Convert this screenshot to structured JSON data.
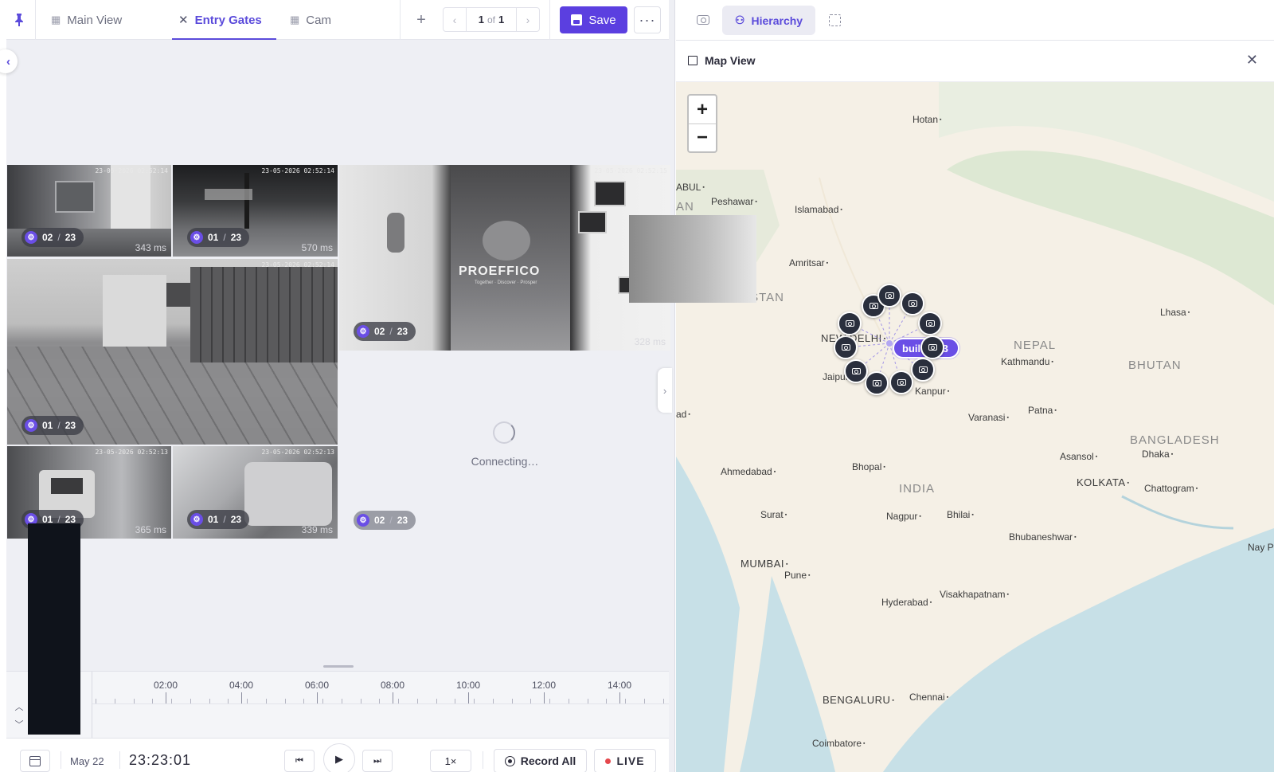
{
  "tabs": [
    {
      "label": "Main View",
      "icon": "layout-icon",
      "active": false
    },
    {
      "label": "Entry Gates",
      "icon": "close-icon",
      "active": true
    },
    {
      "label": "Cam",
      "icon": "layout-icon",
      "active": false
    }
  ],
  "pager": {
    "current": "1",
    "of_label": "of",
    "total": "1"
  },
  "toolbar": {
    "save_label": "Save",
    "more_label": "···"
  },
  "cameras": [
    {
      "stamp": "23-05-2026 02:52:14",
      "count": "02",
      "sep": "/",
      "total": "23",
      "latency": "343 ms"
    },
    {
      "stamp": "23-05-2026 02:52:14",
      "count": "01",
      "sep": "/",
      "total": "23",
      "latency": "570 ms"
    },
    {
      "stamp": "23-05-2026 02:52:15",
      "count": "02",
      "sep": "/",
      "total": "23",
      "latency": "328 ms",
      "watermark": "PROEFFICO",
      "watermark_sub": "Together · Discover · Prosper"
    },
    {
      "stamp": "23-05-2026 02:52:14",
      "count": "01",
      "sep": "/",
      "total": "23",
      "latency": ""
    },
    {
      "stamp": "23-05-2026 02:52:13",
      "count": "01",
      "sep": "/",
      "total": "23",
      "latency": "365 ms"
    },
    {
      "stamp": "23-05-2026 02:52:13",
      "count": "01",
      "sep": "/",
      "total": "23",
      "latency": "339 ms"
    }
  ],
  "connecting": {
    "text": "Connecting…",
    "count": "02",
    "sep": "/",
    "total": "23"
  },
  "timeline": {
    "ticks": [
      {
        "label": "02:00"
      },
      {
        "label": "04:00"
      },
      {
        "label": "06:00"
      },
      {
        "label": "08:00"
      },
      {
        "label": "10:00"
      },
      {
        "label": "12:00"
      },
      {
        "label": "14:00"
      }
    ]
  },
  "controls": {
    "date": "May 22",
    "time": "23:23:01",
    "speed": "1×",
    "record_all": "Record All",
    "live": "LIVE"
  },
  "right_panel": {
    "hierarchy_label": "Hierarchy",
    "map_title": "Map View",
    "cluster_label": "buil…323",
    "zoom_in": "+",
    "zoom_out": "−"
  },
  "map_places": {
    "hotan": "Hotan",
    "kabul": "ABUL",
    "peshawar": "Peshawar",
    "islamabad": "Islamabad",
    "amritsar": "Amritsar",
    "pakistan": "PAKISTAN",
    "lhasa": "Lhasa",
    "nepal": "NEPAL",
    "kathmandu": "Kathmandu",
    "bhutan": "BHUTAN",
    "new_delhi": "NEW DELHI",
    "jaipur": "Jaipur",
    "kanpur": "Kanpur",
    "varanasi": "Varanasi",
    "patna": "Patna",
    "bangladesh": "BANGLADESH",
    "asansol": "Asansol",
    "dhaka": "Dhaka",
    "kolkata": "KOLKATA",
    "chattogram": "Chattogram",
    "ahmedabad": "Ahmedabad",
    "bhopal": "Bhopal",
    "india": "INDIA",
    "surat": "Surat",
    "nagpur": "Nagpur",
    "bhilai": "Bhilai",
    "bhubaneshwar": "Bhubaneshwar",
    "mumbai": "MUMBAI",
    "pune": "Pune",
    "hyderabad": "Hyderabad",
    "visakhapatnam": "Visakhapatnam",
    "bengaluru": "BENGALURU",
    "chennai": "Chennai",
    "coimbatore": "Coimbatore",
    "nay_pyi": "Nay Pyi",
    "ad": "ad",
    "an": "AN"
  },
  "colors": {
    "accent": "#5b3fe0",
    "live_dot": "#e5484d",
    "map_bg": "#f6f1e7"
  }
}
